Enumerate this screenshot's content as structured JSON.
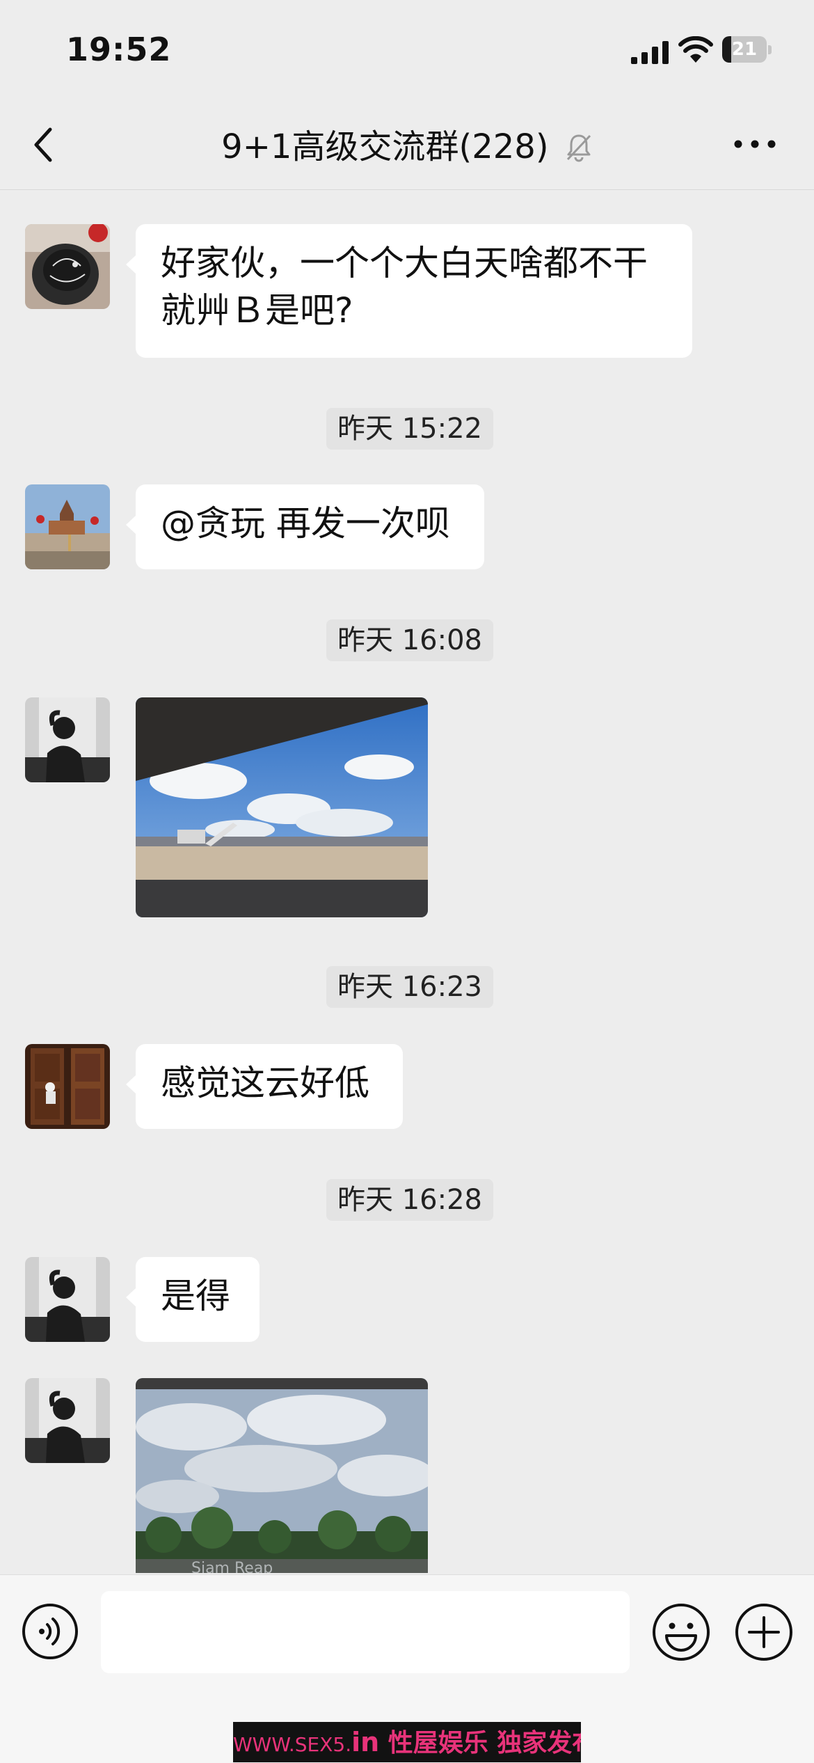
{
  "status_bar": {
    "time": "19:52",
    "battery": "21",
    "battery_level": 0.21
  },
  "header": {
    "title": "9+1高级交流群(228)"
  },
  "messages": [
    {
      "type": "text",
      "text_line1": "好家伙，一个个大白天啥都不干",
      "text_line2": "就艸Ｂ是吧?"
    },
    {
      "type": "timestamp",
      "text": "昨天 15:22"
    },
    {
      "type": "text",
      "text": "@贪玩 再发一次呗"
    },
    {
      "type": "timestamp",
      "text": "昨天 16:08"
    },
    {
      "type": "image",
      "description": "airport-tarmac-photo"
    },
    {
      "type": "timestamp",
      "text": "昨天 16:23"
    },
    {
      "type": "text",
      "text": "感觉这云好低"
    },
    {
      "type": "timestamp",
      "text": "昨天 16:28"
    },
    {
      "type": "text",
      "text": "是得"
    },
    {
      "type": "image",
      "photo_caption": "Siam Reap"
    }
  ],
  "input": {
    "value": "",
    "placeholder": ""
  },
  "watermark": {
    "url": "WWW.SEX5.",
    "tld": "in",
    "text": " 性屋娱乐 独家发布"
  },
  "colors": {
    "background": "#ededed",
    "bubble": "#ffffff",
    "watermark": "#e8337a"
  }
}
